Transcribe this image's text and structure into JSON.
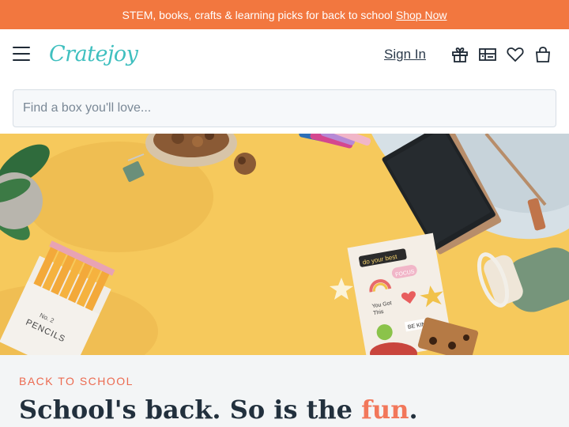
{
  "promo_bar": {
    "text": "STEM, books, crafts & learning picks for back to school",
    "link_label": "Shop Now"
  },
  "header": {
    "logo_text": "Cratejoy",
    "sign_in_label": "Sign In",
    "icons": [
      "menu-icon",
      "gift-icon",
      "gift-card-icon",
      "heart-icon",
      "shopping-bag-icon"
    ]
  },
  "search": {
    "placeholder": "Find a box you'll love..."
  },
  "hero": {
    "image_items": [
      "pencil box",
      "sticker sheet",
      "backpack",
      "notebook",
      "water bottle",
      "plant",
      "snack bowl"
    ],
    "pencil_box_text": "No. 2 PENCILS",
    "sticker_words": [
      "do your best",
      "FOCUS",
      "You Got This",
      "BE KIND"
    ]
  },
  "feature": {
    "eyebrow": "BACK TO SCHOOL",
    "headline_start": "School's back. So is the ",
    "headline_accent": "fun",
    "headline_end": "."
  },
  "colors": {
    "promo_bg": "#f2773f",
    "brand_teal": "#3fbfbf",
    "hero_bg": "#f7cc60",
    "accent": "#f2775a"
  }
}
